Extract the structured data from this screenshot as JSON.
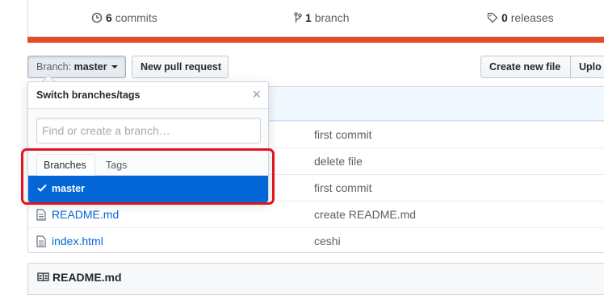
{
  "summary": {
    "commits_count": "6",
    "commits_label": "commits",
    "branches_count": "1",
    "branches_label": "branch",
    "releases_count": "0",
    "releases_label": "releases"
  },
  "colors": {
    "language_bar": "#e34c26",
    "highlight": "#e0141c",
    "selected": "#0366d6"
  },
  "toolbar": {
    "branch_prefix": "Branch:",
    "branch_name": "master",
    "new_pull_request": "New pull request",
    "create_new_file": "Create new file",
    "upload": "Uplo"
  },
  "files": [
    {
      "name": "",
      "message": "first commit",
      "icon": ""
    },
    {
      "name": "",
      "message": "delete file",
      "icon": ""
    },
    {
      "name": "",
      "message": "first commit",
      "icon": ""
    },
    {
      "name": "README.md",
      "message": "create README.md",
      "icon": "file-icon"
    },
    {
      "name": "index.html",
      "message": "ceshi",
      "icon": "file-icon"
    }
  ],
  "readme": {
    "title": "README.md",
    "icon": "book-icon"
  },
  "dropdown": {
    "title": "Switch branches/tags",
    "close": "×",
    "filter_placeholder": "Find or create a branch…",
    "tabs": [
      "Branches",
      "Tags"
    ],
    "selected_branch": "master"
  }
}
